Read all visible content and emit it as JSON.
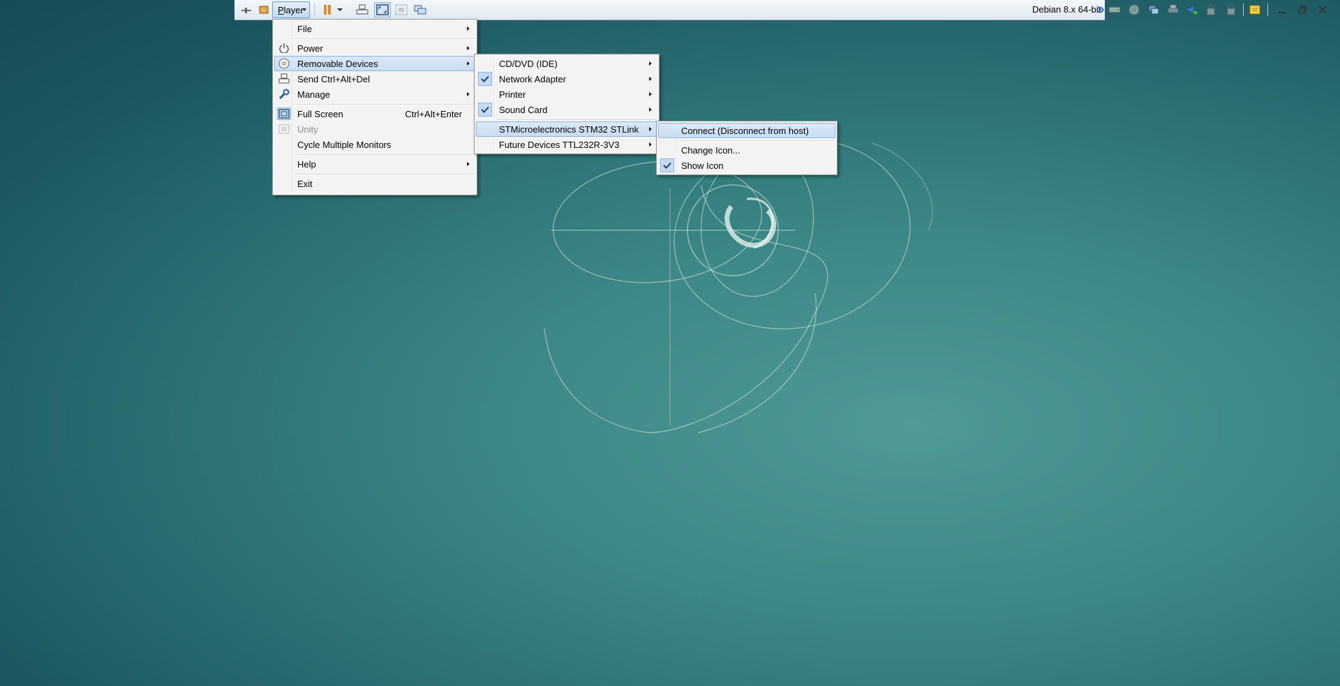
{
  "toolbar": {
    "player_label": "Player",
    "vm_name": "Debian 8.x 64-bit",
    "icons": [
      "pin-icon",
      "library-icon",
      "pause-icon",
      "send-ctrl-alt-del-icon",
      "fullscreen-icon",
      "unity-icon",
      "cycle-monitors-icon",
      "hard-disk-icon",
      "cd-dvd-icon",
      "network-adapter-icon",
      "printer-icon",
      "sound-card-icon",
      "usb-device-icon",
      "usb-device-icon",
      "messages-icon",
      "minimize-icon",
      "restore-icon",
      "close-icon"
    ]
  },
  "player_menu": {
    "items": [
      {
        "label": "File"
      },
      {
        "label": "Power"
      },
      {
        "label": "Removable Devices"
      },
      {
        "label": "Send Ctrl+Alt+Del"
      },
      {
        "label": "Manage"
      },
      {
        "label": "Full Screen",
        "shortcut": "Ctrl+Alt+Enter"
      },
      {
        "label": "Unity"
      },
      {
        "label": "Cycle Multiple Monitors"
      },
      {
        "label": "Help"
      },
      {
        "label": "Exit"
      }
    ]
  },
  "devices_menu": {
    "items": [
      {
        "label": "CD/DVD (IDE)"
      },
      {
        "label": "Network Adapter",
        "checked": true
      },
      {
        "label": "Printer"
      },
      {
        "label": "Sound Card",
        "checked": true
      },
      {
        "label": "STMicroelectronics STM32 STLink"
      },
      {
        "label": "Future Devices TTL232R-3V3"
      }
    ]
  },
  "stlink_menu": {
    "items": [
      {
        "label": "Connect (Disconnect from host)"
      },
      {
        "label": "Change Icon..."
      },
      {
        "label": "Show Icon",
        "checked": true
      }
    ]
  },
  "colors": {
    "highlight": "#c9ddf3",
    "highlight_border": "#8fb3de",
    "menu_bg": "#f3f3f3",
    "desktop": "#3c8886"
  }
}
